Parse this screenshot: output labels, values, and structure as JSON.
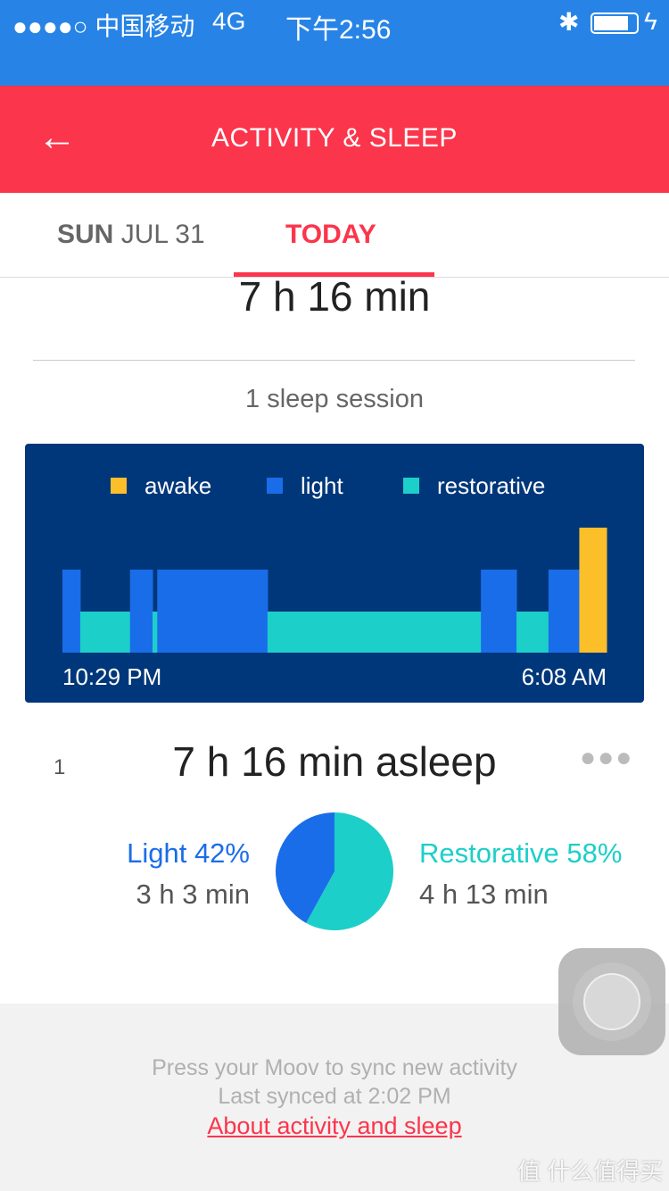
{
  "status_bar": {
    "carrier": "●●●●○ 中国移动",
    "network": "4G",
    "time": "下午2:56",
    "bluetooth_icon": "bluetooth-icon",
    "battery_icon": "battery-charging-icon"
  },
  "header": {
    "title": "ACTIVITY & SLEEP",
    "back_icon": "arrow-left-icon",
    "color": "#fb354b"
  },
  "tabs": [
    {
      "day": "SUN",
      "date": "JUL 31"
    },
    {
      "label": "TODAY",
      "active": true
    }
  ],
  "summary": {
    "total": "7 h 16 min",
    "sessions": "1 sleep session"
  },
  "chart_data": {
    "type": "bar",
    "legend": [
      {
        "name": "awake",
        "color": "#fbbf2a"
      },
      {
        "name": "light",
        "color": "#1a6de8"
      },
      {
        "name": "restorative",
        "color": "#1ccfc9"
      }
    ],
    "start_label": "10:29 PM",
    "end_label": "6:08 AM",
    "segments_minutes": [
      {
        "stage": "light",
        "minutes": 15
      },
      {
        "stage": "restorative",
        "minutes": 42
      },
      {
        "stage": "light",
        "minutes": 19
      },
      {
        "stage": "restorative",
        "minutes": 4
      },
      {
        "stage": "light",
        "minutes": 93
      },
      {
        "stage": "restorative",
        "minutes": 180
      },
      {
        "stage": "light",
        "minutes": 30
      },
      {
        "stage": "restorative",
        "minutes": 27
      },
      {
        "stage": "light",
        "minutes": 26
      },
      {
        "stage": "awake",
        "minutes": 23
      }
    ]
  },
  "session": {
    "index": "1",
    "title": "7 h 16 min asleep",
    "more_icon": "more-horizontal-icon",
    "light": {
      "label": "Light 42%",
      "percent": 42,
      "duration": "3 h 3 min"
    },
    "restorative": {
      "label": "Restorative 58%",
      "percent": 58,
      "duration": "4 h 13 min"
    }
  },
  "footer": {
    "line1": "Press your Moov to sync new activity",
    "line2": "Last synced at 2:02 PM",
    "link": "About activity and sleep"
  },
  "watermark": "值 什么值得买"
}
